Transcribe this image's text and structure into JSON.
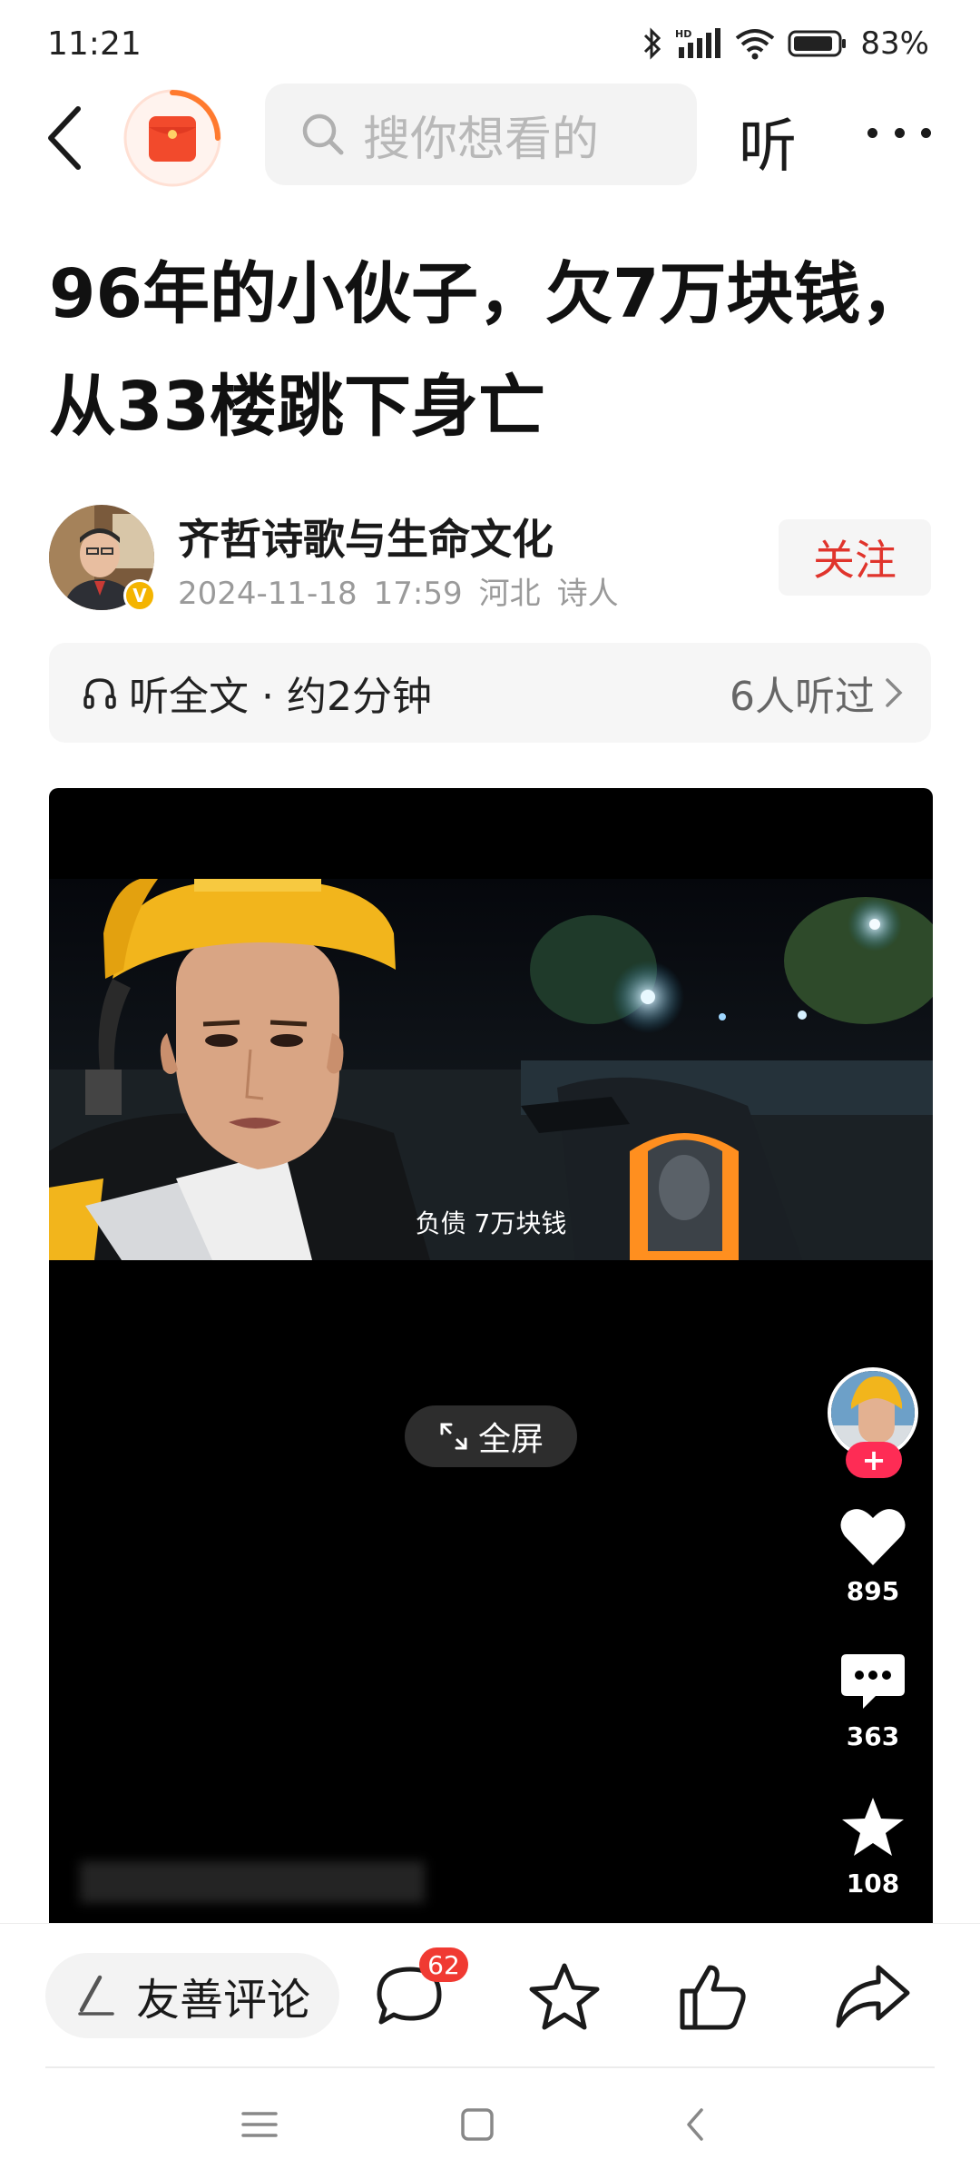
{
  "status_bar": {
    "time": "11:21",
    "network_label": "HD",
    "battery": "83%"
  },
  "nav": {
    "search_placeholder": "搜你想看的",
    "listen_label": "听"
  },
  "article": {
    "title": "96年的小伙子，欠7万块钱，从33楼跳下身亡"
  },
  "author": {
    "name": "齐哲诗歌与生命文化",
    "date": "2024-11-18",
    "time": "17:59",
    "location": "河北",
    "role": "诗人",
    "verified_mark": "V",
    "follow_label": "关注"
  },
  "listen_bar": {
    "label": "听全文 · 约2分钟",
    "listeners": "6人听过"
  },
  "video": {
    "subtitle": "负债 7万块钱",
    "fullscreen_label": "全屏",
    "follow_plus": "+",
    "likes": "895",
    "comments": "363",
    "favorites": "108"
  },
  "bottom_bar": {
    "comment_placeholder": "友善评论",
    "comment_count": "62"
  },
  "colors": {
    "accent_red": "#e0342c",
    "badge_red": "#f03a32",
    "helmet_yellow": "#f2b51c"
  },
  "icons": [
    "back-icon",
    "red-packet-icon",
    "search-icon",
    "more-icon",
    "headphones-icon",
    "chevron-right-icon",
    "fullscreen-icon",
    "heart-icon",
    "comment-bubble-icon",
    "star-icon",
    "pen-icon",
    "thumbs-up-icon",
    "share-icon",
    "menu-icon",
    "home-square-icon",
    "back-triangle-icon"
  ]
}
